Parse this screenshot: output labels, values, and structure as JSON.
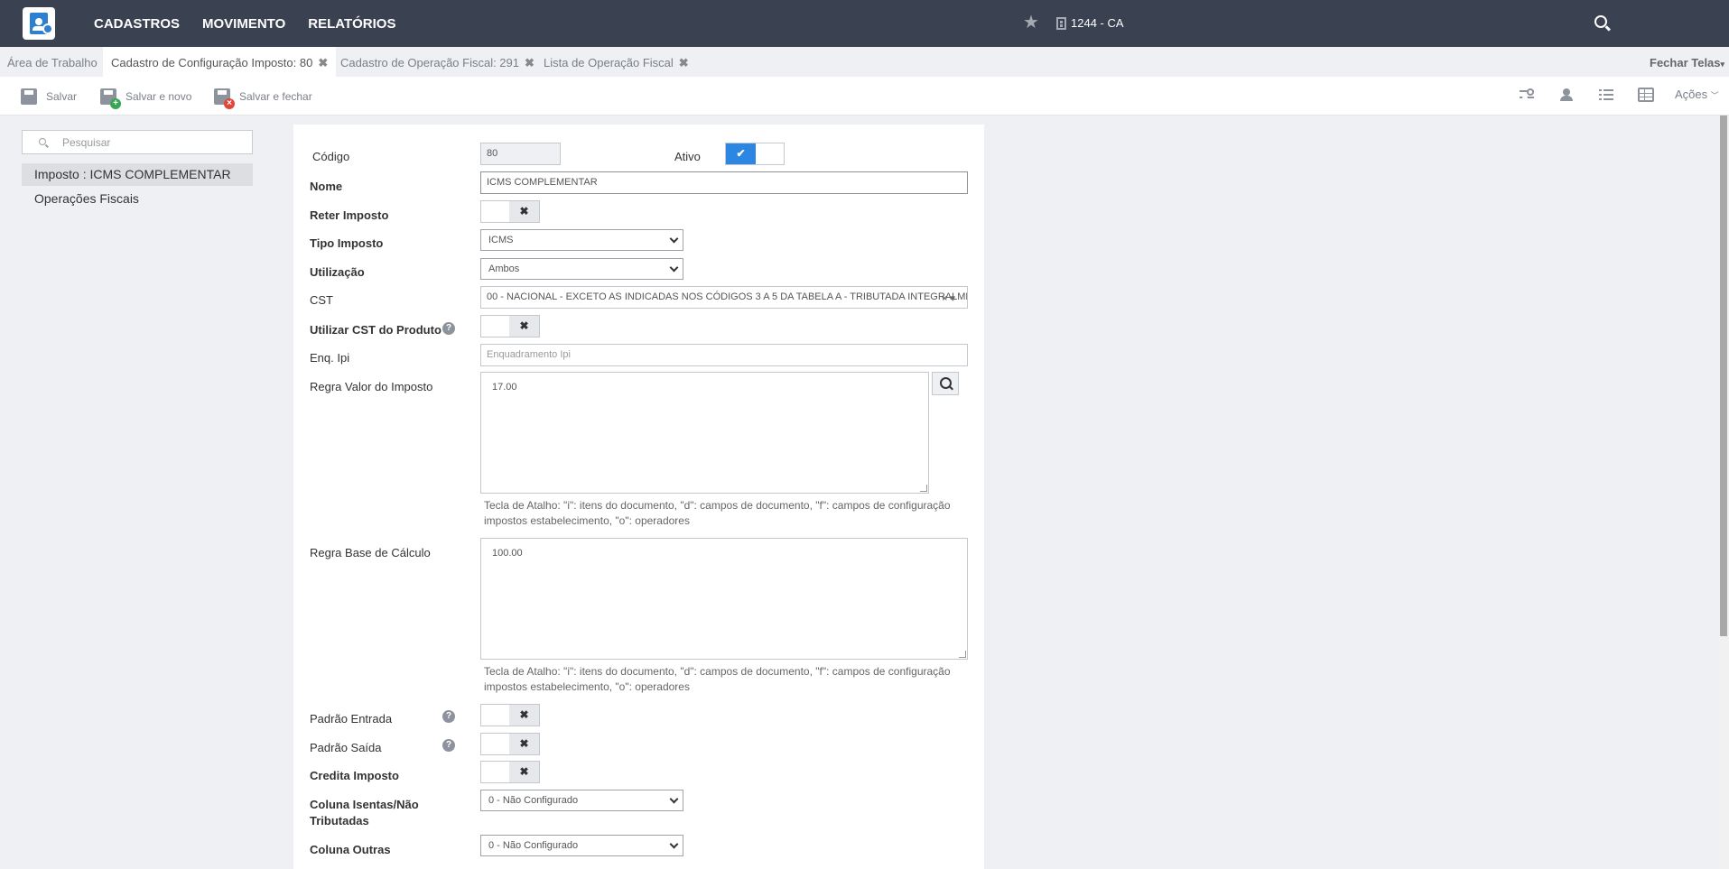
{
  "topbar": {
    "menu": [
      "CADASTROS",
      "MOVIMENTO",
      "RELATÓRIOS"
    ],
    "establishment": "1244 - CA"
  },
  "tabs": [
    {
      "label": "Área de Trabalho",
      "closable": false
    },
    {
      "label": "Cadastro de Configuração Imposto: 80",
      "closable": true,
      "active": true
    },
    {
      "label": "Cadastro de Operação Fiscal: 291",
      "closable": true
    },
    {
      "label": "Lista de Operação Fiscal",
      "closable": true
    }
  ],
  "tab_close_glyph": "✖",
  "fechar_telas": "Fechar Telas",
  "toolbar": {
    "save": "Salvar",
    "save_new": "Salvar e novo",
    "save_close": "Salvar e fechar",
    "actions": "Ações"
  },
  "sidebar": {
    "search_placeholder": "Pesquisar",
    "items": [
      "Imposto : ICMS COMPLEMENTAR",
      "Operações Fiscais"
    ]
  },
  "form": {
    "codigo_label": "Código",
    "codigo_value": "80",
    "ativo_label": "Ativo",
    "nome_label": "Nome",
    "nome_value": "ICMS COMPLEMENTAR",
    "reter_label": "Reter Imposto",
    "tipo_label": "Tipo Imposto",
    "tipo_value": "ICMS",
    "utilizacao_label": "Utilização",
    "utilizacao_value": "Ambos",
    "cst_label": "CST",
    "cst_value": "00 - NACIONAL - EXCETO AS INDICADAS NOS CÓDIGOS 3 A 5 DA TABELA A - TRIBUTADA INTEGRALME...",
    "cst_clear": "× ▾",
    "utilizar_cst_label": "Utilizar CST do Produto",
    "enq_label": "Enq. Ipi",
    "enq_placeholder": "Enquadramento Ipi",
    "regra_valor_label": "Regra Valor do Imposto",
    "regra_valor_value": "17.00",
    "hint": "Tecla de Atalho: \"i\": itens do documento, \"d\": campos de documento, \"f\": campos de configuração impostos estabelecimento, \"o\": operadores",
    "regra_base_label": "Regra Base de Cálculo",
    "regra_base_value": "100.00",
    "padrao_entrada_label": "Padrão Entrada",
    "padrao_saida_label": "Padrão Saída",
    "credita_label": "Credita Imposto",
    "coluna_isentas_label": "Coluna Isentas/Não Tributadas",
    "coluna_isentas_value": "0 - Não Configurado",
    "coluna_outras_label": "Coluna Outras",
    "coluna_outras_value": "0 - Não Configurado"
  },
  "toggle_off_glyph": "✖",
  "toggle_on_glyph": "✔",
  "help_glyph": "?",
  "colors": {
    "topbar": "#3a4150",
    "toggle_on": "#2d87e2",
    "badge_add": "#3aa655",
    "badge_close": "#e0463a"
  }
}
